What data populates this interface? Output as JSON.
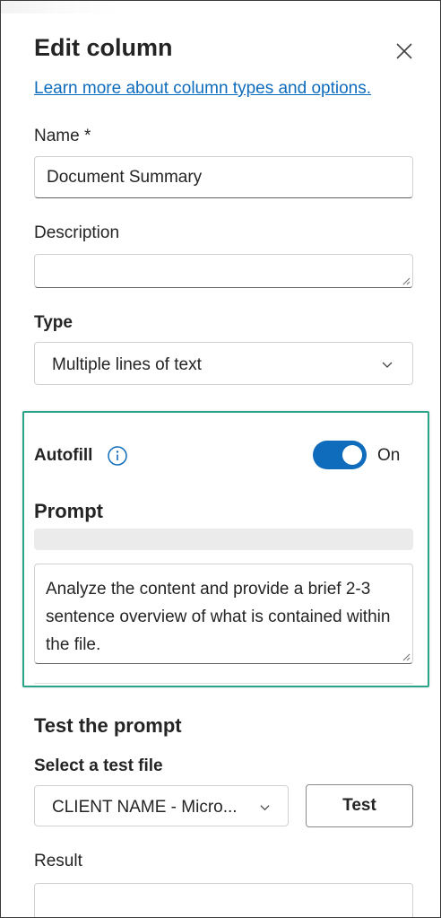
{
  "panel": {
    "title": "Edit column",
    "learn_more_link": "Learn more about column types and options."
  },
  "name_field": {
    "label": "Name *",
    "value": "Document Summary"
  },
  "description_field": {
    "label": "Description",
    "value": ""
  },
  "type_field": {
    "label": "Type",
    "selected": "Multiple lines of text"
  },
  "autofill": {
    "label": "Autofill",
    "toggle_state": "On",
    "toggle_on": true,
    "highlight_color": "#2aa388",
    "toggle_color": "#0f6cbd"
  },
  "prompt": {
    "label": "Prompt",
    "value": "Analyze the content and provide a brief 2-3 sentence overview of what is contained within the file."
  },
  "test_section": {
    "heading": "Test the prompt",
    "select_label": "Select a test file",
    "selected_file": "CLIENT NAME - Micro...",
    "test_button": "Test",
    "result_label": "Result"
  },
  "icons": {
    "close": "close-icon",
    "info": "info-icon",
    "dropdown": "chevron-down-icon"
  }
}
